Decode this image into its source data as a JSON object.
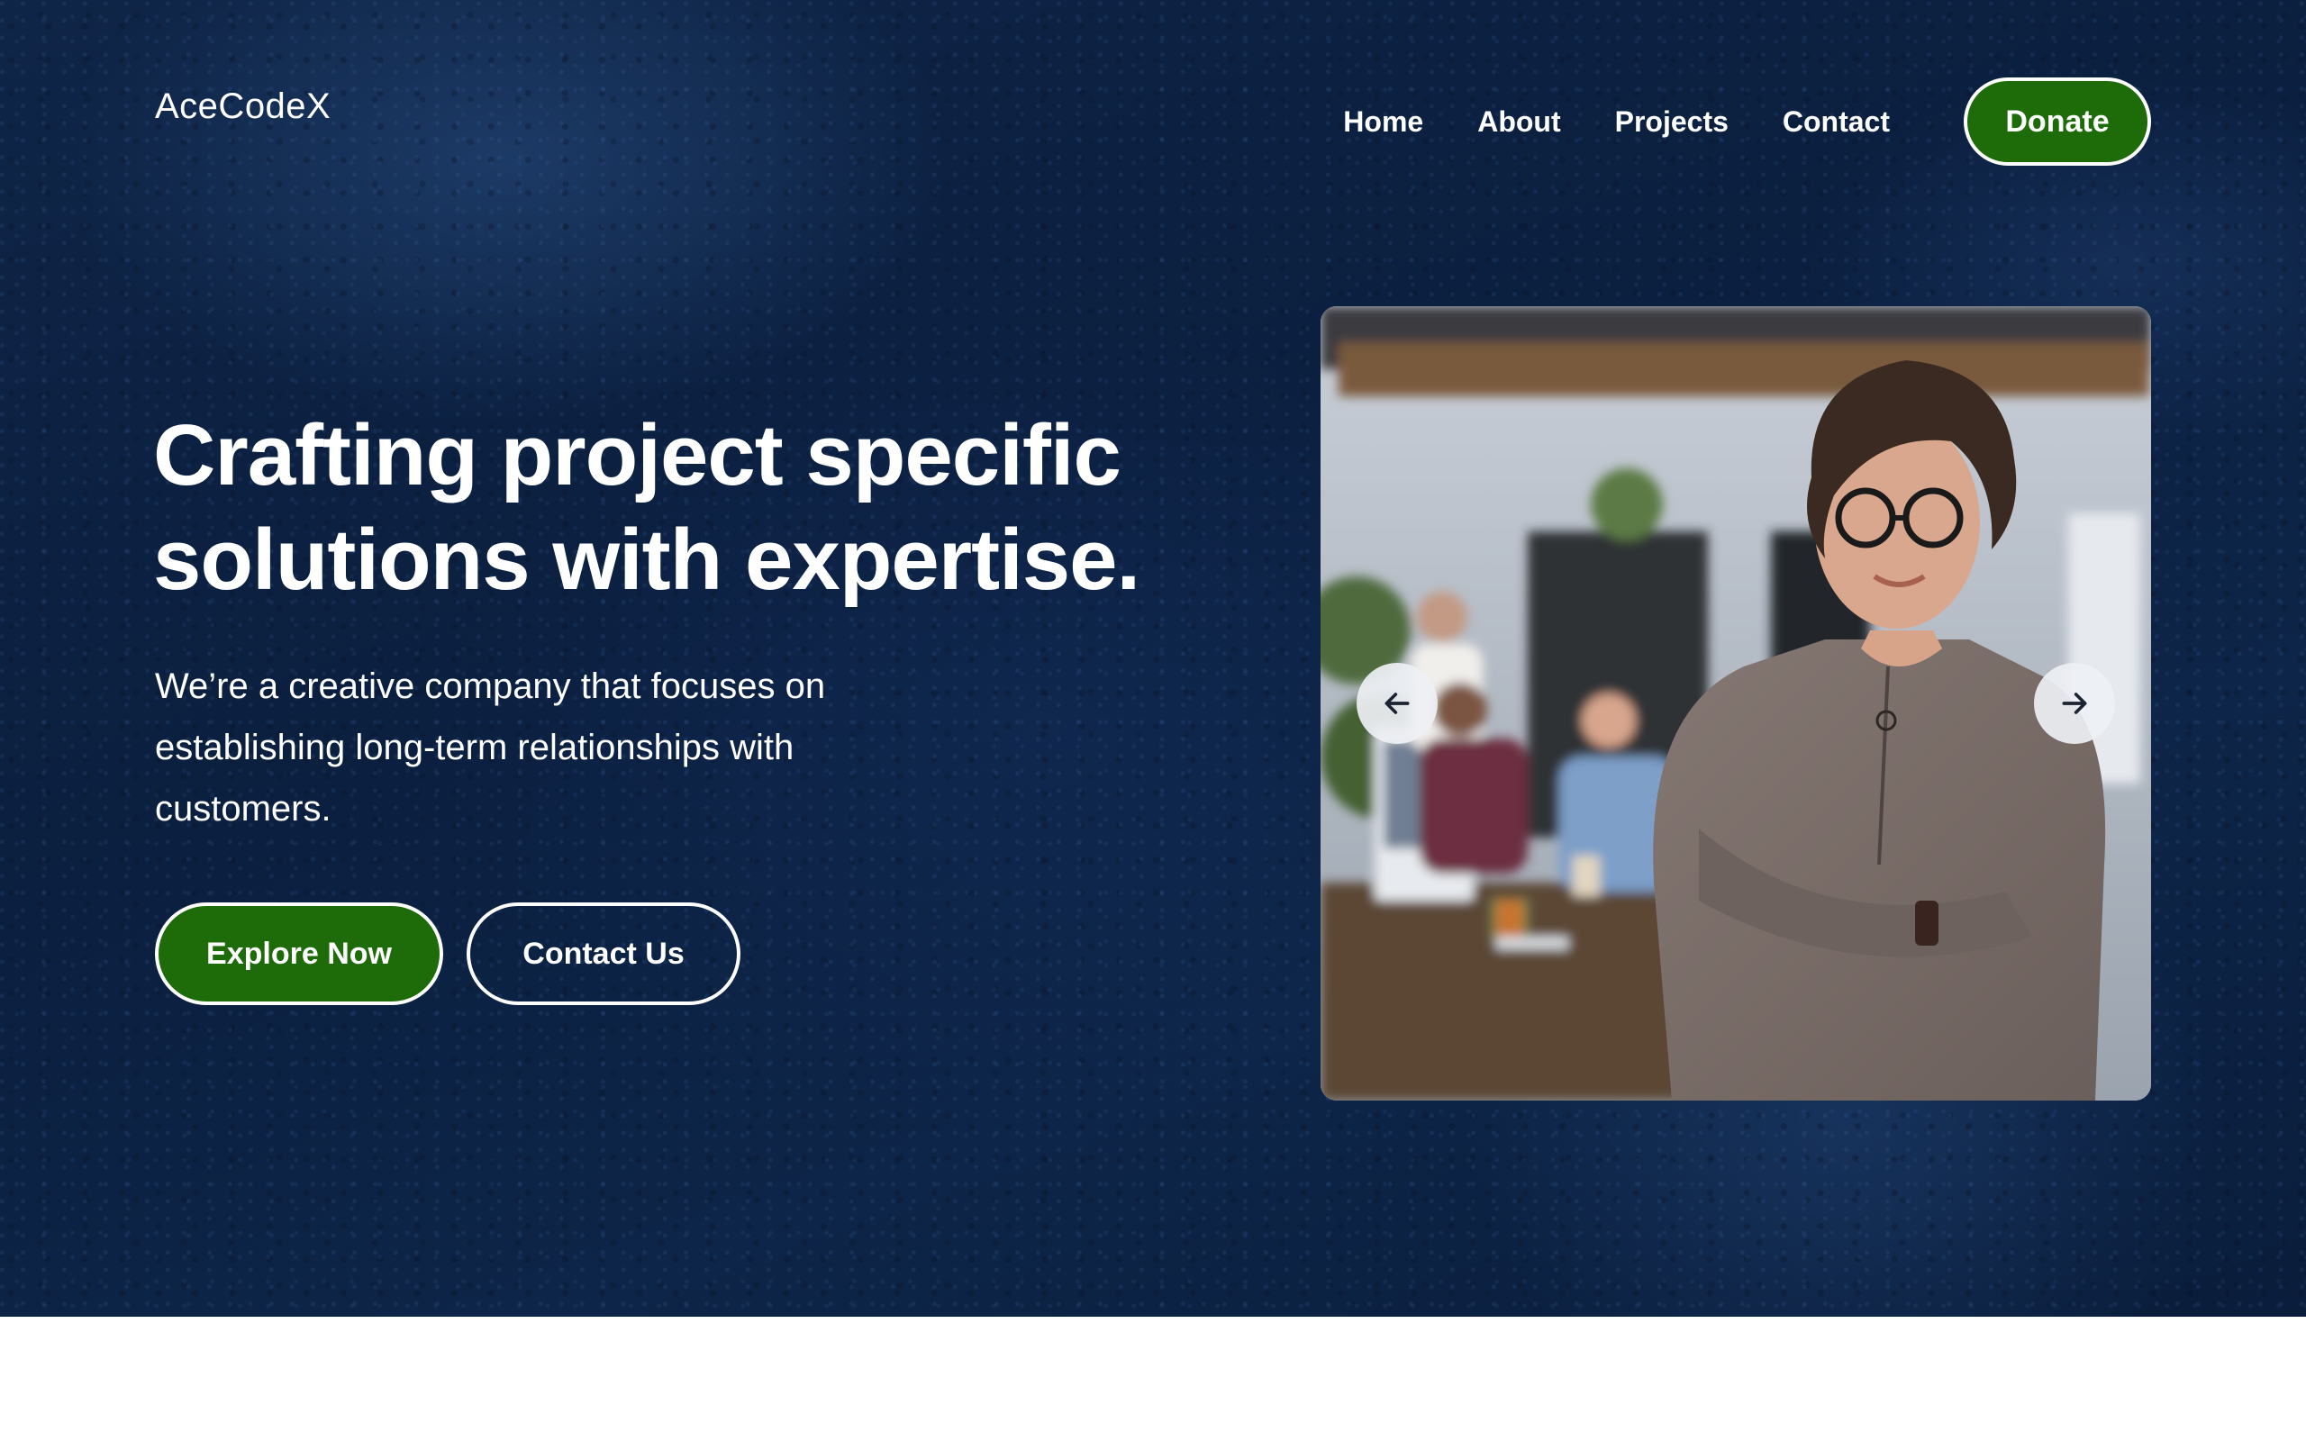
{
  "brand": {
    "name": "AceCodeX"
  },
  "nav": {
    "links": [
      "Home",
      "About",
      "Projects",
      "Contact"
    ],
    "donate_label": "Donate"
  },
  "hero": {
    "headline_line1": "Crafting project specific",
    "headline_line2": "solutions with expertise.",
    "subtext_line1": "We’re a creative company that focuses on",
    "subtext_line2": "establishing long-term relationships with",
    "subtext_line3": "customers.",
    "primary_cta": "Explore Now",
    "secondary_cta": "Contact Us"
  },
  "slider": {
    "prev_icon": "arrow-left-icon",
    "next_icon": "arrow-right-icon"
  },
  "colors": {
    "background": "#0d2548",
    "accent_green": "#1e6b0a",
    "text": "#ffffff"
  }
}
